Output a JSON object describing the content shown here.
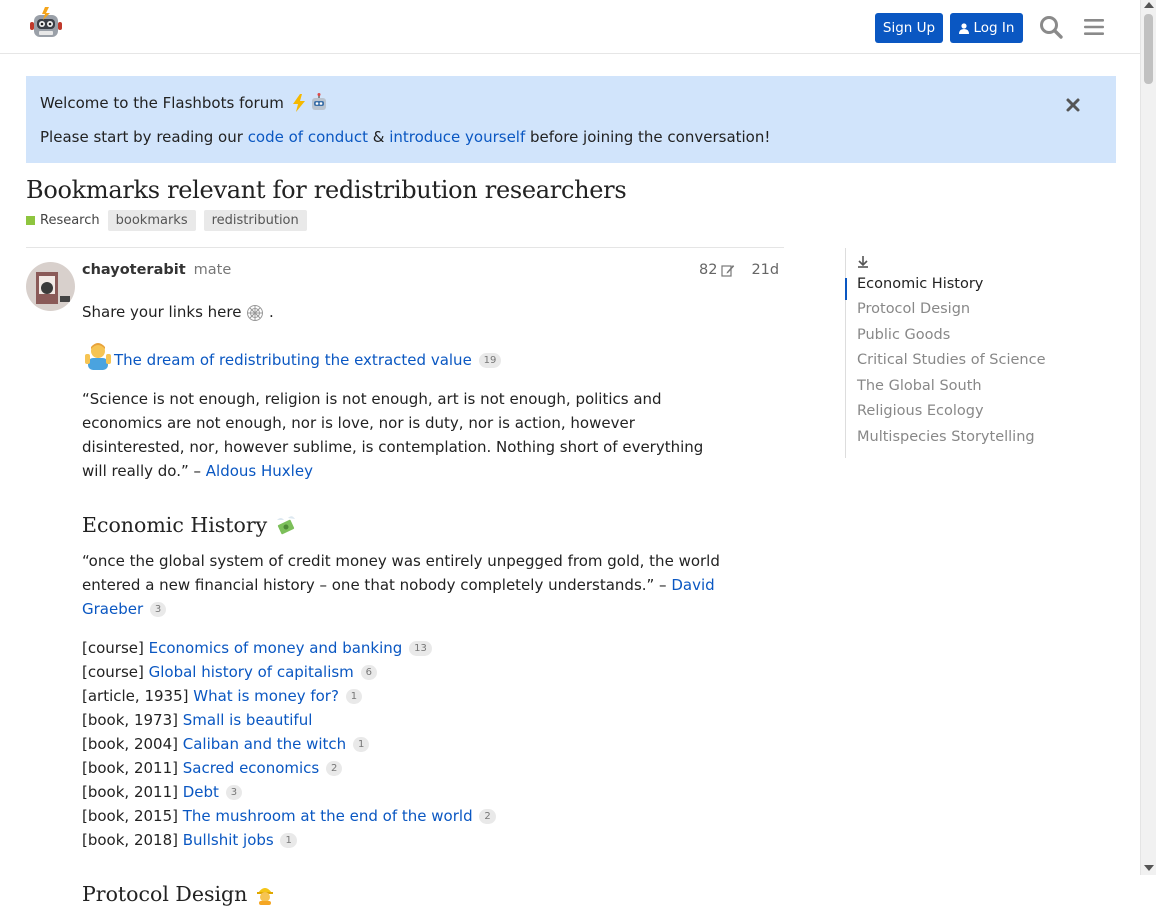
{
  "header": {
    "signup_label": "Sign Up",
    "login_label": "Log In"
  },
  "banner": {
    "welcome_text": "Welcome to the Flashbots forum",
    "intro_before": "Please start by reading our ",
    "link_conduct": "code of conduct",
    "intro_amp": " & ",
    "link_introduce": "introduce yourself",
    "intro_after": " before joining the conversation!"
  },
  "topic": {
    "title": "Bookmarks relevant for redistribution researchers",
    "category": "Research",
    "tags": [
      "bookmarks",
      "redistribution"
    ]
  },
  "post": {
    "username": "chayoterabit",
    "user_title": "mate",
    "edits": "82",
    "date": "21d",
    "share_text": "Share your links here",
    "share_end": " .",
    "featured_link": "The dream of redistributing the extracted value",
    "featured_count": "19",
    "quote_text": "“Science is not enough, religion is not enough, art is not enough, politics and economics are not enough, nor is love, nor is duty, nor is action, however disinterested, nor, however sublime, is contemplation. Nothing short of everything will really do.” – ",
    "quote_author": "Aldous Huxley",
    "section1_heading": "Economic History",
    "section1_quote": "“once the global system of credit money was entirely unpegged from gold, the world entered a new financial history – one that nobody completely understands.” – ",
    "section1_quote_author": "David Graeber",
    "section1_quote_count": "3",
    "items": [
      {
        "prefix": "[course] ",
        "link": "Economics of money and banking",
        "count": "13"
      },
      {
        "prefix": "[course] ",
        "link": "Global history of capitalism",
        "count": "6"
      },
      {
        "prefix": "[article, 1935] ",
        "link": "What is money for?",
        "count": "1"
      },
      {
        "prefix": "[book, 1973] ",
        "link": "Small is beautiful",
        "count": ""
      },
      {
        "prefix": "[book, 2004] ",
        "link": "Caliban and the witch",
        "count": "1"
      },
      {
        "prefix": "[book, 2011] ",
        "link": "Sacred economics",
        "count": "2"
      },
      {
        "prefix": "[book, 2011] ",
        "link": "Debt",
        "count": "3"
      },
      {
        "prefix": "[book, 2015] ",
        "link": "The mushroom at the end of the world",
        "count": "2"
      },
      {
        "prefix": "[book, 2018] ",
        "link": "Bullshit jobs",
        "count": "1"
      }
    ],
    "section2_heading": "Protocol Design"
  },
  "toc": {
    "items": [
      "Economic History",
      "Protocol Design",
      "Public Goods",
      "Critical Studies of Science",
      "The Global South",
      "Religious Ecology",
      "Multispecies Storytelling"
    ]
  },
  "colors": {
    "accent": "#0a57c2",
    "banner_bg": "#d1e4fb",
    "category": "#8ec53f"
  }
}
